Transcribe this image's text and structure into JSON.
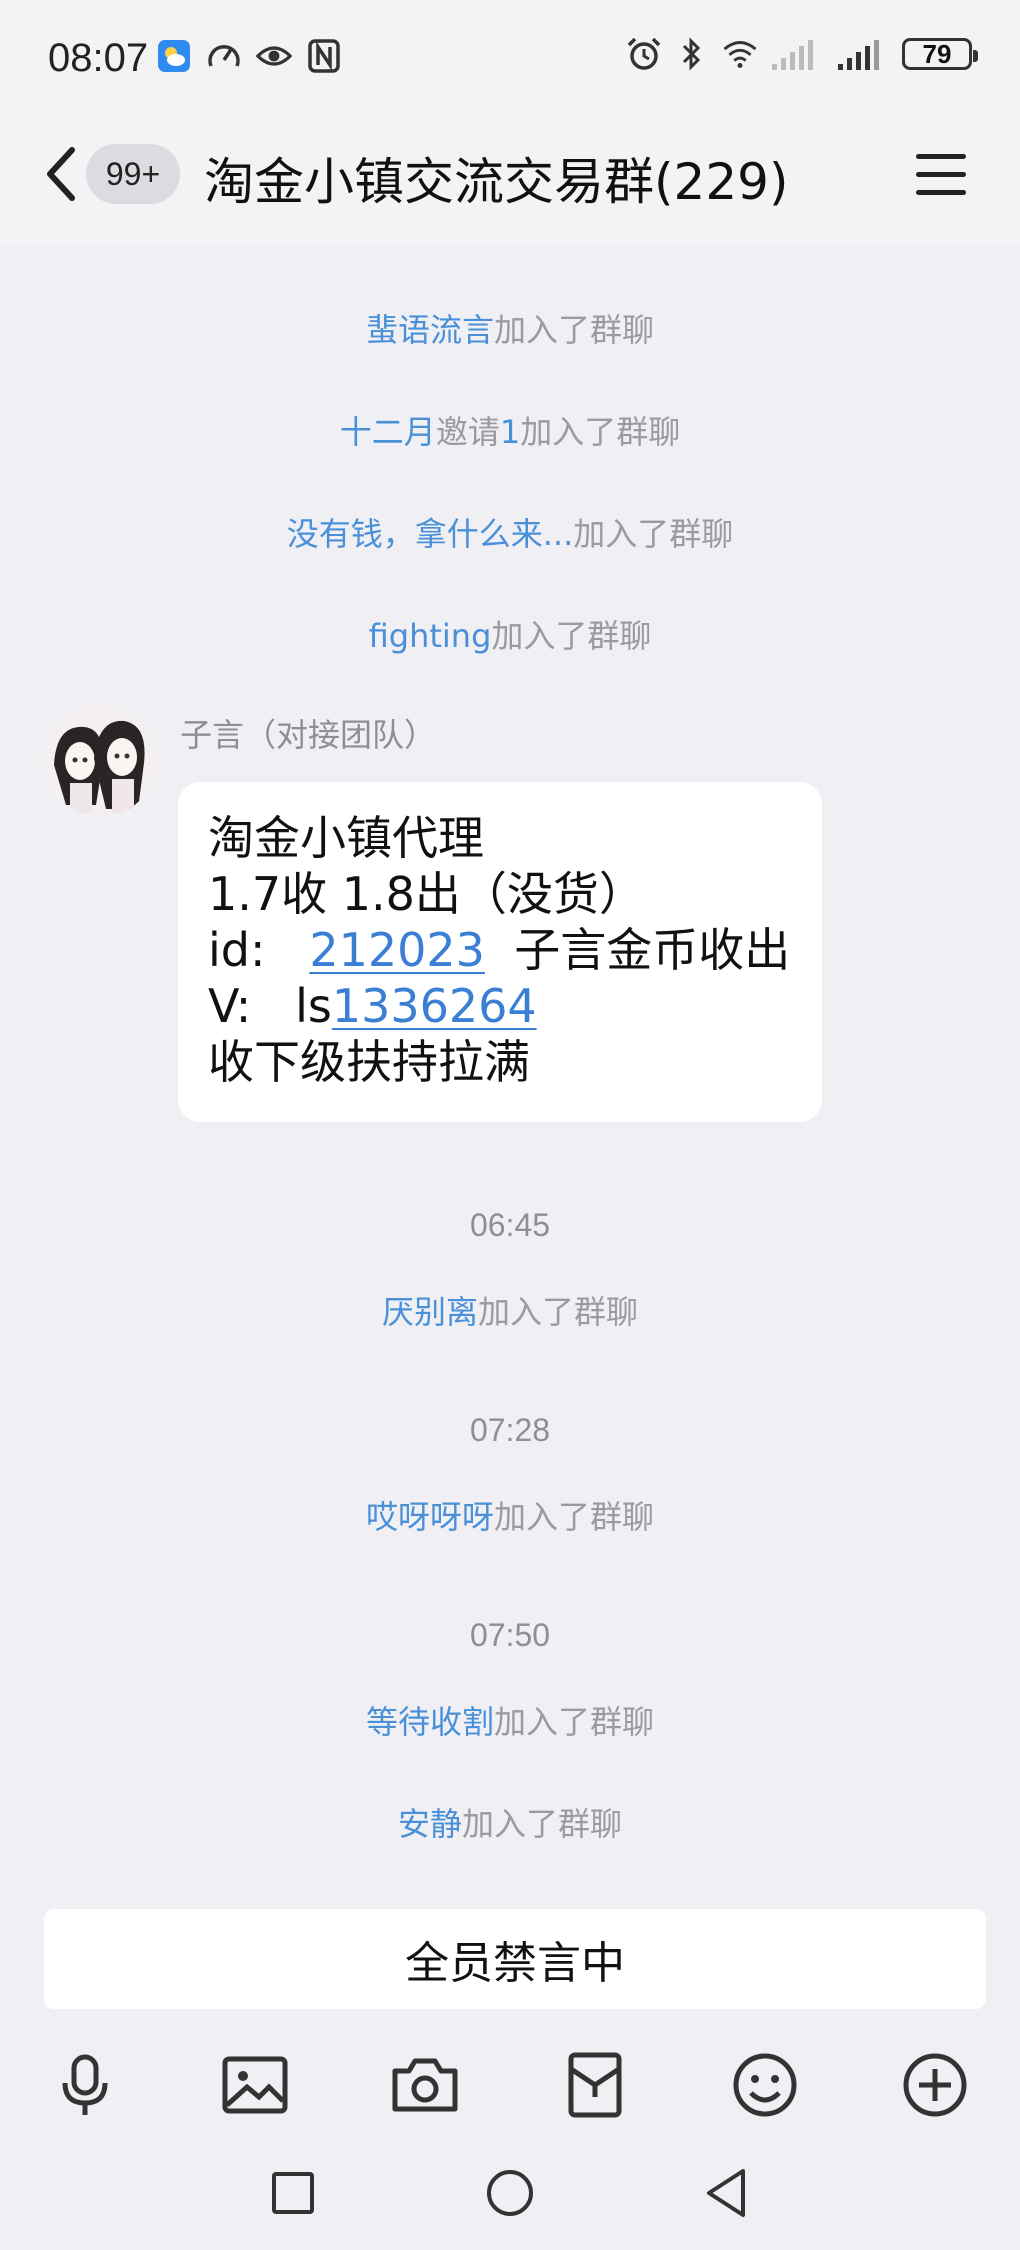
{
  "status_bar": {
    "time": "08:07",
    "battery": "79",
    "left_icons": [
      "weather-icon",
      "speed-icon",
      "eye-icon",
      "nfc-icon"
    ],
    "right_icons": [
      "alarm-icon",
      "bluetooth-icon",
      "wifi-icon",
      "signal-icon",
      "signal-icon",
      "battery-icon"
    ]
  },
  "header": {
    "unread_badge": "99+",
    "title": "淘金小镇交流交易群(229)"
  },
  "messages": {
    "joins_top": [
      {
        "nick": "蜚语流言",
        "text": "加入了群聊"
      },
      {
        "nick": "十二月",
        "mid": "邀请",
        "nick2": "1",
        "text": "加入了群聊"
      },
      {
        "nick": "没有钱，拿什么来...",
        "text": "加入了群聊"
      },
      {
        "nick": "fighting",
        "text": "加入了群聊"
      }
    ],
    "post": {
      "sender": "子言（对接团队）",
      "line1": "淘金小镇代理",
      "line2": "1.7收  1.8出（没货）",
      "line3_prefix": "id:   ",
      "line3_link": "212023",
      "line3_suffix": "  子言金币收出",
      "line4_prefix": "V:   ls",
      "line4_link": "1336264",
      "line5": "收下级扶持拉满"
    },
    "time1": "06:45",
    "join5": {
      "nick": "厌别离",
      "text": "加入了群聊"
    },
    "time2": "07:28",
    "join6": {
      "nick": "哎呀呀呀",
      "text": "加入了群聊"
    },
    "time3": "07:50",
    "join7": {
      "nick": "等待收割",
      "text": "加入了群聊"
    },
    "join8": {
      "nick": "安静",
      "text": "加入了群聊"
    }
  },
  "input": {
    "muted_text": "全员禁言中"
  },
  "toolbar": [
    "microphone-icon",
    "image-icon",
    "camera-icon",
    "red-packet-icon",
    "emoji-icon",
    "plus-icon"
  ],
  "colors": {
    "background": "#efeff4",
    "nickname": "#4a90d9",
    "system_text": "#9a9a9f",
    "link": "#3b7fd4"
  }
}
